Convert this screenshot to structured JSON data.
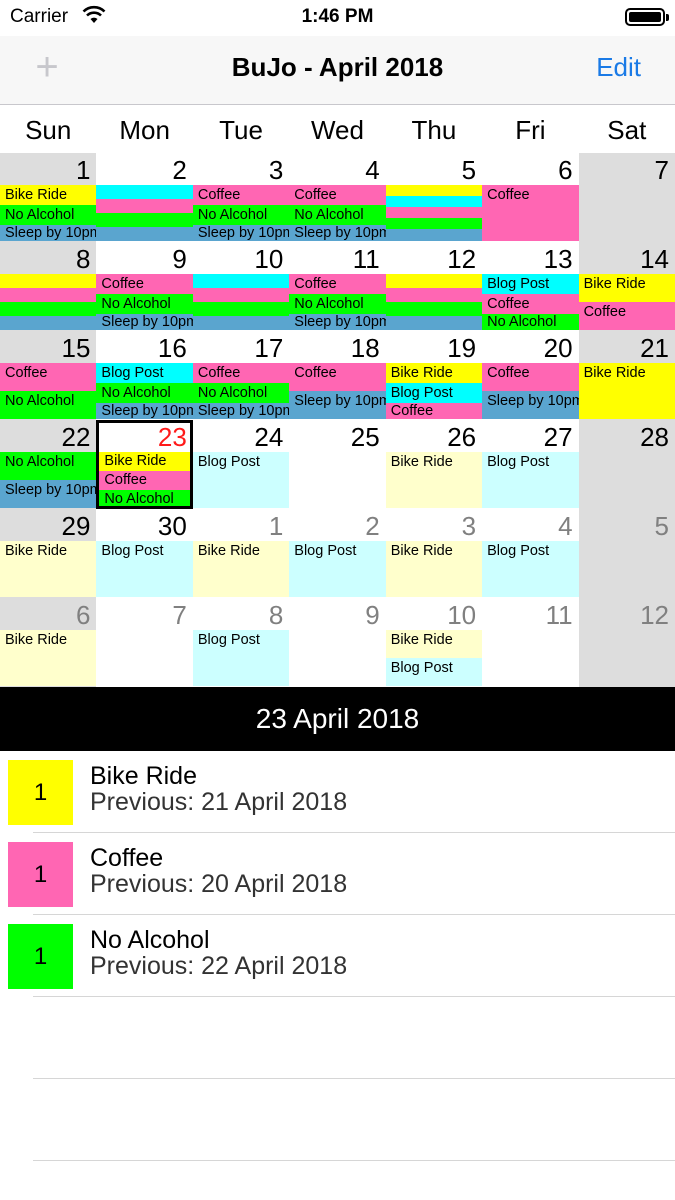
{
  "status_bar": {
    "carrier": "Carrier",
    "time": "1:46 PM",
    "wifi_icon": "wifi-icon",
    "battery_icon": "battery-icon"
  },
  "nav": {
    "add_icon": "plus-icon",
    "title": "BuJo - April 2018",
    "edit_label": "Edit"
  },
  "colors": {
    "bike": "#ffff00",
    "coffee": "#ff66b3",
    "noalc": "#00ff00",
    "sleep": "#5aa5cf",
    "blog": "#00ffff",
    "bike_future": "#ffffcc",
    "blog_future": "#ccffff",
    "weekend": "#dddddd",
    "accent": "#1a7ae6",
    "today": "#ff1a1a"
  },
  "weekdays": [
    "Sun",
    "Mon",
    "Tue",
    "Wed",
    "Thu",
    "Fri",
    "Sat"
  ],
  "calendar": {
    "weeks": [
      [
        {
          "day": "1",
          "bg": "weekend",
          "strips": [
            {
              "c": "bike",
              "t": "Bike Ride",
              "h": 20
            },
            {
              "c": "noalc",
              "t": "No Alcohol",
              "h": 20
            },
            {
              "c": "sleep",
              "t": "Sleep by 10pm",
              "h": 16
            }
          ]
        },
        {
          "day": "2",
          "bg": "white",
          "strips": [
            {
              "c": "blog",
              "t": "",
              "h": 14
            },
            {
              "c": "coffee",
              "t": "",
              "h": 14
            },
            {
              "c": "noalc",
              "t": "",
              "h": 14
            },
            {
              "c": "sleep",
              "t": "",
              "h": 14
            }
          ]
        },
        {
          "day": "3",
          "bg": "white",
          "strips": [
            {
              "c": "coffee",
              "t": "Coffee",
              "h": 20
            },
            {
              "c": "noalc",
              "t": "No Alcohol",
              "h": 20
            },
            {
              "c": "sleep",
              "t": "Sleep by 10pm",
              "h": 16
            }
          ]
        },
        {
          "day": "4",
          "bg": "white",
          "strips": [
            {
              "c": "coffee",
              "t": "Coffee",
              "h": 20
            },
            {
              "c": "noalc",
              "t": "No Alcohol",
              "h": 20
            },
            {
              "c": "sleep",
              "t": "Sleep by 10pm",
              "h": 16
            }
          ]
        },
        {
          "day": "5",
          "bg": "white",
          "strips": [
            {
              "c": "bike",
              "t": "",
              "h": 11
            },
            {
              "c": "blog",
              "t": "",
              "h": 11
            },
            {
              "c": "coffee",
              "t": "",
              "h": 11
            },
            {
              "c": "noalc",
              "t": "",
              "h": 11
            },
            {
              "c": "sleep",
              "t": "",
              "h": 12
            }
          ]
        },
        {
          "day": "6",
          "bg": "white",
          "strips": [
            {
              "c": "coffee",
              "t": "Coffee",
              "h": 56
            }
          ]
        },
        {
          "day": "7",
          "bg": "weekend",
          "strips": []
        }
      ],
      [
        {
          "day": "8",
          "bg": "weekend",
          "strips": [
            {
              "c": "bike",
              "t": "",
              "h": 14
            },
            {
              "c": "coffee",
              "t": "",
              "h": 14
            },
            {
              "c": "noalc",
              "t": "",
              "h": 14
            },
            {
              "c": "sleep",
              "t": "",
              "h": 14
            }
          ]
        },
        {
          "day": "9",
          "bg": "white",
          "strips": [
            {
              "c": "coffee",
              "t": "Coffee",
              "h": 20
            },
            {
              "c": "noalc",
              "t": "No Alcohol",
              "h": 20
            },
            {
              "c": "sleep",
              "t": "Sleep by 10pm",
              "h": 16
            }
          ]
        },
        {
          "day": "10",
          "bg": "white",
          "strips": [
            {
              "c": "blog",
              "t": "",
              "h": 14
            },
            {
              "c": "coffee",
              "t": "",
              "h": 14
            },
            {
              "c": "noalc",
              "t": "",
              "h": 14
            },
            {
              "c": "sleep",
              "t": "",
              "h": 14
            }
          ]
        },
        {
          "day": "11",
          "bg": "white",
          "strips": [
            {
              "c": "coffee",
              "t": "Coffee",
              "h": 20
            },
            {
              "c": "noalc",
              "t": "No Alcohol",
              "h": 20
            },
            {
              "c": "sleep",
              "t": "Sleep by 10pm",
              "h": 16
            }
          ]
        },
        {
          "day": "12",
          "bg": "white",
          "strips": [
            {
              "c": "bike",
              "t": "",
              "h": 14
            },
            {
              "c": "coffee",
              "t": "",
              "h": 14
            },
            {
              "c": "noalc",
              "t": "",
              "h": 14
            },
            {
              "c": "sleep",
              "t": "",
              "h": 14
            }
          ]
        },
        {
          "day": "13",
          "bg": "white",
          "strips": [
            {
              "c": "blog",
              "t": "Blog Post",
              "h": 20
            },
            {
              "c": "coffee",
              "t": "Coffee",
              "h": 20
            },
            {
              "c": "noalc",
              "t": "No Alcohol",
              "h": 16
            }
          ]
        },
        {
          "day": "14",
          "bg": "weekend",
          "strips": [
            {
              "c": "bike",
              "t": "Bike Ride",
              "h": 28
            },
            {
              "c": "coffee",
              "t": "Coffee",
              "h": 28
            }
          ]
        }
      ],
      [
        {
          "day": "15",
          "bg": "weekend",
          "strips": [
            {
              "c": "coffee",
              "t": "Coffee",
              "h": 28
            },
            {
              "c": "noalc",
              "t": "No Alcohol",
              "h": 28
            }
          ]
        },
        {
          "day": "16",
          "bg": "white",
          "strips": [
            {
              "c": "blog",
              "t": "Blog Post",
              "h": 20
            },
            {
              "c": "noalc",
              "t": "No Alcohol",
              "h": 20
            },
            {
              "c": "sleep",
              "t": "Sleep by 10pm",
              "h": 16
            }
          ]
        },
        {
          "day": "17",
          "bg": "white",
          "strips": [
            {
              "c": "coffee",
              "t": "Coffee",
              "h": 20
            },
            {
              "c": "noalc",
              "t": "No Alcohol",
              "h": 20
            },
            {
              "c": "sleep",
              "t": "Sleep by 10pm",
              "h": 16
            }
          ]
        },
        {
          "day": "18",
          "bg": "white",
          "strips": [
            {
              "c": "coffee",
              "t": "Coffee",
              "h": 28
            },
            {
              "c": "sleep",
              "t": "Sleep by 10pm",
              "h": 28
            }
          ]
        },
        {
          "day": "19",
          "bg": "white",
          "strips": [
            {
              "c": "bike",
              "t": "Bike Ride",
              "h": 20
            },
            {
              "c": "blog",
              "t": "Blog Post",
              "h": 20
            },
            {
              "c": "coffee",
              "t": "Coffee",
              "h": 16
            }
          ]
        },
        {
          "day": "20",
          "bg": "white",
          "strips": [
            {
              "c": "coffee",
              "t": "Coffee",
              "h": 28
            },
            {
              "c": "sleep",
              "t": "Sleep by 10pm",
              "h": 28
            }
          ]
        },
        {
          "day": "21",
          "bg": "weekend",
          "strips": [
            {
              "c": "bike",
              "t": "Bike Ride",
              "h": 56
            }
          ]
        }
      ],
      [
        {
          "day": "22",
          "bg": "weekend",
          "strips": [
            {
              "c": "noalc",
              "t": "No Alcohol",
              "h": 28
            },
            {
              "c": "sleep",
              "t": "Sleep by 10pm",
              "h": 28
            }
          ]
        },
        {
          "day": "23",
          "bg": "white",
          "today": true,
          "selected": true,
          "strips": [
            {
              "c": "bike",
              "t": "Bike Ride",
              "h": 19
            },
            {
              "c": "coffee",
              "t": "Coffee",
              "h": 19
            },
            {
              "c": "noalc",
              "t": "No Alcohol",
              "h": 18
            }
          ]
        },
        {
          "day": "24",
          "bg": "white",
          "strips": [
            {
              "c": "blog_future",
              "t": "Blog Post",
              "h": 56
            }
          ]
        },
        {
          "day": "25",
          "bg": "white",
          "strips": []
        },
        {
          "day": "26",
          "bg": "white",
          "strips": [
            {
              "c": "bike_future",
              "t": "Bike Ride",
              "h": 56
            }
          ]
        },
        {
          "day": "27",
          "bg": "white",
          "strips": [
            {
              "c": "blog_future",
              "t": "Blog Post",
              "h": 56
            }
          ]
        },
        {
          "day": "28",
          "bg": "weekend",
          "strips": []
        }
      ],
      [
        {
          "day": "29",
          "bg": "weekend",
          "strips": [
            {
              "c": "bike_future",
              "t": "Bike Ride",
              "h": 56
            }
          ]
        },
        {
          "day": "30",
          "bg": "white",
          "strips": [
            {
              "c": "blog_future",
              "t": "Blog Post",
              "h": 56
            }
          ]
        },
        {
          "day": "1",
          "bg": "white",
          "other": true,
          "strips": [
            {
              "c": "bike_future",
              "t": "Bike Ride",
              "h": 56
            }
          ]
        },
        {
          "day": "2",
          "bg": "white",
          "other": true,
          "strips": [
            {
              "c": "blog_future",
              "t": "Blog Post",
              "h": 56
            }
          ]
        },
        {
          "day": "3",
          "bg": "white",
          "other": true,
          "strips": [
            {
              "c": "bike_future",
              "t": "Bike Ride",
              "h": 56
            }
          ]
        },
        {
          "day": "4",
          "bg": "white",
          "other": true,
          "strips": [
            {
              "c": "blog_future",
              "t": "Blog Post",
              "h": 56
            }
          ]
        },
        {
          "day": "5",
          "bg": "weekend",
          "other": true,
          "strips": []
        }
      ],
      [
        {
          "day": "6",
          "bg": "weekend",
          "other": true,
          "strips": [
            {
              "c": "bike_future",
              "t": "Bike Ride",
              "h": 56
            }
          ]
        },
        {
          "day": "7",
          "bg": "white",
          "other": true,
          "strips": []
        },
        {
          "day": "8",
          "bg": "white",
          "other": true,
          "strips": [
            {
              "c": "blog_future",
              "t": "Blog Post",
              "h": 56
            }
          ]
        },
        {
          "day": "9",
          "bg": "white",
          "other": true,
          "strips": []
        },
        {
          "day": "10",
          "bg": "white",
          "other": true,
          "strips": [
            {
              "c": "bike_future",
              "t": "Bike Ride",
              "h": 28
            },
            {
              "c": "blog_future",
              "t": "Blog Post",
              "h": 28
            }
          ]
        },
        {
          "day": "11",
          "bg": "white",
          "other": true,
          "strips": []
        },
        {
          "day": "12",
          "bg": "weekend",
          "other": true,
          "strips": []
        }
      ]
    ]
  },
  "selected_date": "23 April 2018",
  "habits": [
    {
      "count": "1",
      "name": "Bike Ride",
      "previous": "Previous: 21 April 2018",
      "color": "bike"
    },
    {
      "count": "1",
      "name": "Coffee",
      "previous": "Previous: 20 April 2018",
      "color": "coffee"
    },
    {
      "count": "1",
      "name": "No Alcohol",
      "previous": "Previous: 22 April 2018",
      "color": "noalc"
    }
  ]
}
